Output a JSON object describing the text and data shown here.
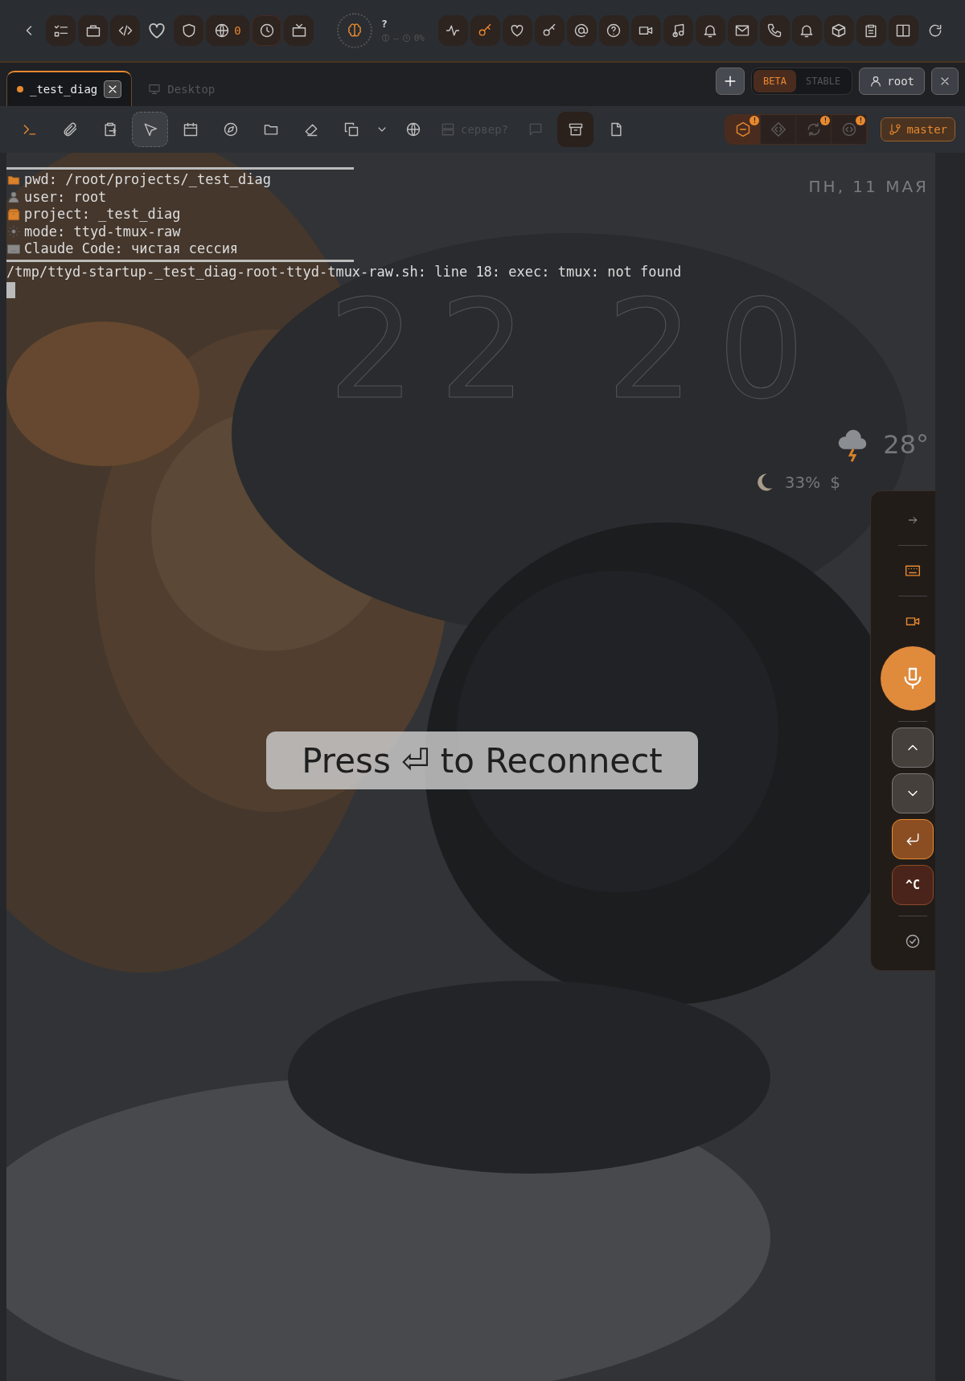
{
  "top_bar": {
    "globe_count": "0",
    "ai_status": {
      "title": "?",
      "separator": "—",
      "percent": "0%"
    }
  },
  "tabs": [
    {
      "label": "_test_diag",
      "selected": true,
      "closable": true
    },
    {
      "label": "Desktop",
      "selected": false,
      "closable": false
    }
  ],
  "channels": [
    {
      "label": "BETA",
      "selected": true
    },
    {
      "label": "STABLE",
      "selected": false
    }
  ],
  "user": "root",
  "tools": [
    {
      "kind": "tool",
      "selected": false,
      "disabled": false
    },
    {
      "kind": "tool",
      "selected": false,
      "disabled": false
    },
    {
      "kind": "tool",
      "selected": false,
      "disabled": false
    },
    {
      "kind": "tool",
      "selected": true,
      "disabled": false
    },
    {
      "kind": "tool",
      "selected": false,
      "disabled": false
    },
    {
      "kind": "tool",
      "selected": false,
      "disabled": false
    },
    {
      "kind": "tool",
      "selected": false,
      "disabled": false
    },
    {
      "kind": "tool",
      "selected": false,
      "disabled": false
    },
    {
      "kind": "tool",
      "selected": false,
      "disabled": false
    },
    {
      "kind": "dropdown",
      "selected": false,
      "disabled": false
    },
    {
      "kind": "tool",
      "selected": false,
      "disabled": false
    },
    {
      "kind": "labeled",
      "label": "сервер?",
      "selected": false,
      "disabled": true
    },
    {
      "kind": "tool",
      "selected": false,
      "disabled": true
    },
    {
      "kind": "tool",
      "selected": true,
      "disabled": false
    },
    {
      "kind": "tool",
      "selected": false,
      "disabled": false
    }
  ],
  "git_indicators": [
    {
      "selected": true,
      "badge": "!"
    },
    {
      "selected": false
    },
    {
      "selected": false,
      "badge": "!"
    },
    {
      "selected": false,
      "badge": "!"
    }
  ],
  "branch": "master",
  "terminal": {
    "banner_lines": [
      "pwd: /root/projects/_test_diag",
      "user: root",
      "project: _test_diag",
      "mode: ttyd-tmux-raw",
      "Claude Code: чистая сессия"
    ],
    "error_line": "/tmp/ttyd-startup-_test_diag-root-ttyd-tmux-raw.sh: line 18: exec: tmux: not found"
  },
  "clock": {
    "date": "ПН, 11 МАЯ",
    "hours": "22",
    "minutes": "20"
  },
  "weather": {
    "temperature": "28°",
    "moon": "33%",
    "currency": "$"
  },
  "reconnect": "Press ⏎ to Reconnect",
  "side_panel": {
    "interrupt": "^C"
  }
}
